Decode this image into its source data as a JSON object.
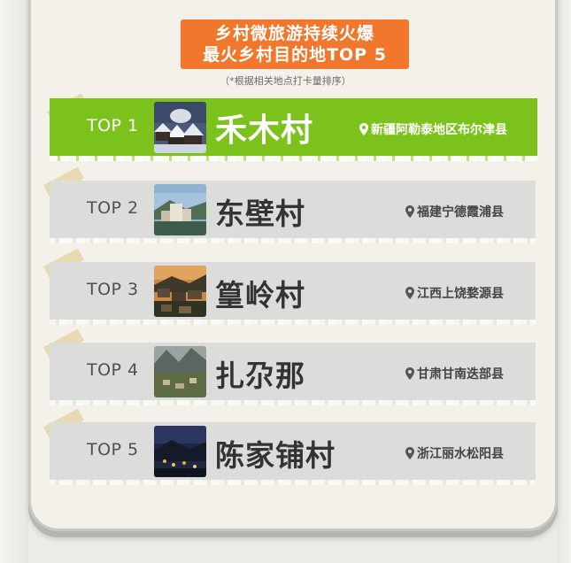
{
  "header": {
    "line1": "乡村微旅游持续火爆",
    "line2": "最火乡村目的地TOP 5",
    "note": "（*根据相关地点打卡量排序）"
  },
  "ranking": [
    {
      "rank": "TOP 1",
      "name": "禾木村",
      "location": "新疆阿勒泰地区布尔津县",
      "thumb": "snowy-village-photo"
    },
    {
      "rank": "TOP 2",
      "name": "东壁村",
      "location": "福建宁德霞浦县",
      "thumb": "coastal-village-photo"
    },
    {
      "rank": "TOP 3",
      "name": "篁岭村",
      "location": "江西上饶婺源县",
      "thumb": "sunset-village-photo"
    },
    {
      "rank": "TOP 4",
      "name": "扎尕那",
      "location": "甘肃甘南迭部县",
      "thumb": "mountain-village-photo"
    },
    {
      "rank": "TOP 5",
      "name": "陈家铺村",
      "location": "浙江丽水松阳县",
      "thumb": "night-village-photo"
    }
  ],
  "colors": {
    "banner": "#f0772c",
    "highlight_row": "#7cc21c",
    "row": "#dcdcda"
  },
  "icons": [
    "map-pin-icon"
  ]
}
